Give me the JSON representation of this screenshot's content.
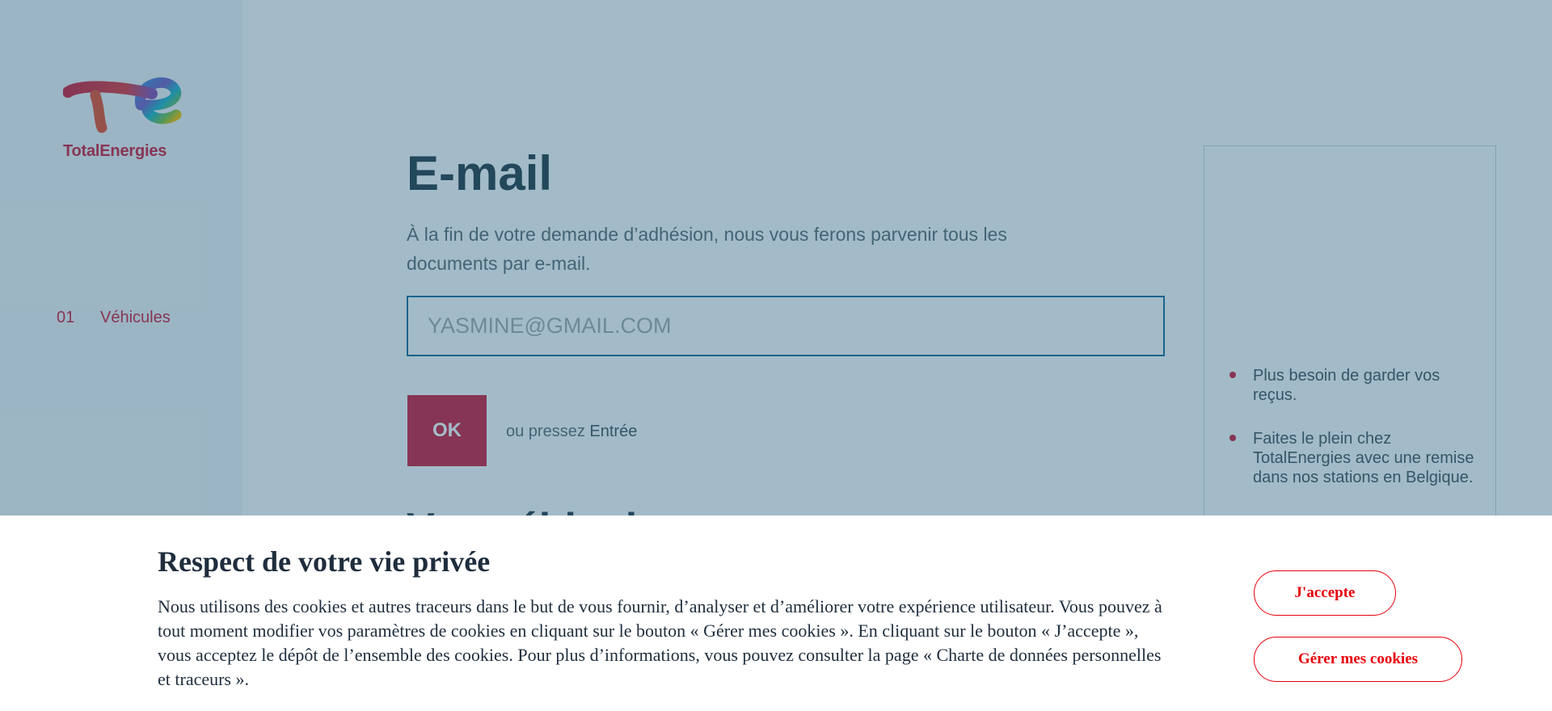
{
  "brand": {
    "name": "TotalEnergies",
    "color": "#d1213f"
  },
  "sidebar": {
    "steps": [
      {
        "number": "01",
        "label": "Véhicules"
      }
    ]
  },
  "form": {
    "title": "E-mail",
    "description": "À la fin de votre demande d’adhésion, nous vous ferons parvenir tous les documents par e-mail.",
    "email_value": "YASMINE@GMAIL.COM",
    "ok_label": "OK",
    "hint_prefix": "ou pressez",
    "hint_key": "Entrée",
    "next_title": "Vos véhicules"
  },
  "benefits": [
    "Plus besoin de garder vos reçus.",
    "Faites le plein chez TotalEnergies avec une remise dans nos stations en Belgique."
  ],
  "cookie_banner": {
    "title": "Respect de votre vie privée",
    "text": "Nous utilisons des cookies et autres traceurs dans le but de vous fournir, d’analyser et d’améliorer votre expérience utilisateur. Vous pouvez à tout moment modifier vos paramètres de cookies en cliquant sur le bouton « Gérer mes cookies ». En cliquant sur le bouton « J’accepte », vous acceptez le dépôt de l’ensemble des cookies. Pour plus d’informations, vous pouvez consulter la page « Charte de données personnelles et traceurs ».",
    "accept_label": "J'accepte",
    "manage_label": "Gérer mes cookies",
    "button_color": "#e8000b"
  }
}
